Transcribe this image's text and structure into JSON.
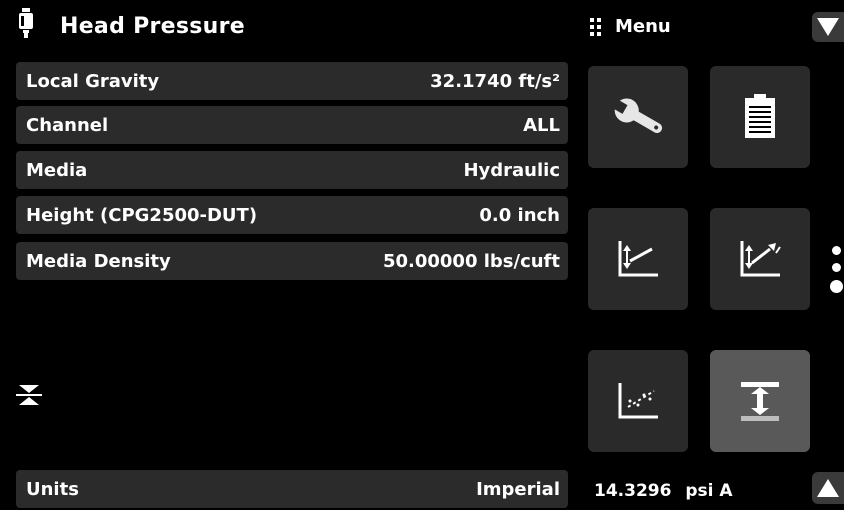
{
  "header": {
    "title": "Head Pressure",
    "icon": "pressure-gauge-icon"
  },
  "menu": {
    "label": "Menu",
    "icon": "grip-icon"
  },
  "settings": [
    {
      "label": "Local Gravity",
      "value": "32.1740 ft/s²"
    },
    {
      "label": "Channel",
      "value": "ALL"
    },
    {
      "label": "Media",
      "value": "Hydraulic"
    },
    {
      "label": "Height (CPG2500-DUT)",
      "value": "0.0 inch"
    },
    {
      "label": "Media Density",
      "value": "50.00000 lbs/cuft"
    }
  ],
  "units": {
    "label": "Units",
    "value": "Imperial"
  },
  "tiles": [
    {
      "name": "wrench-icon"
    },
    {
      "name": "clipboard-icon"
    },
    {
      "name": "chart-down-icon"
    },
    {
      "name": "chart-up-arrows-icon"
    },
    {
      "name": "chart-scatter-icon"
    },
    {
      "name": "head-height-icon",
      "active": true
    }
  ],
  "status": {
    "reading": "14.3296",
    "unit": "psi A"
  },
  "pager": {
    "pages": 3,
    "current": 3
  },
  "colors": {
    "background": "#000000",
    "row": "#2b2b2b",
    "tile": "#2a2a2a",
    "tile_active": "#595959"
  }
}
